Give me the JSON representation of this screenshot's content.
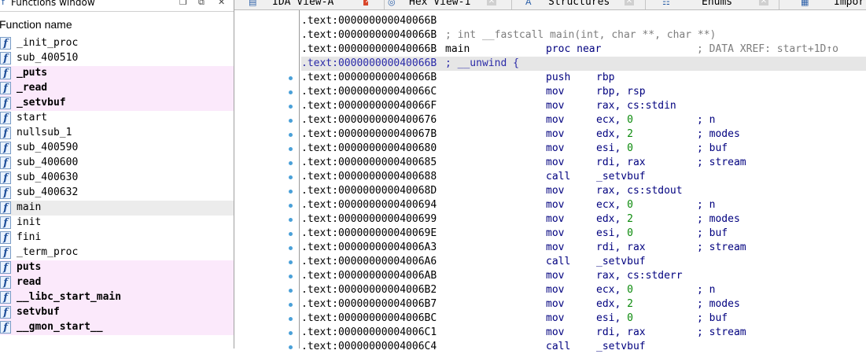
{
  "functions_window": {
    "title": "Functions window",
    "column_header": "Function name",
    "icon_glyph": "f",
    "items": [
      {
        "name": "_init_proc",
        "kind": "normal"
      },
      {
        "name": "sub_400510",
        "kind": "normal"
      },
      {
        "name": "_puts",
        "kind": "lib"
      },
      {
        "name": "_read",
        "kind": "lib"
      },
      {
        "name": "_setvbuf",
        "kind": "lib"
      },
      {
        "name": "start",
        "kind": "normal"
      },
      {
        "name": "nullsub_1",
        "kind": "normal"
      },
      {
        "name": "sub_400590",
        "kind": "normal"
      },
      {
        "name": "sub_400600",
        "kind": "normal"
      },
      {
        "name": "sub_400630",
        "kind": "normal"
      },
      {
        "name": "sub_400632",
        "kind": "normal"
      },
      {
        "name": "main",
        "kind": "selected"
      },
      {
        "name": "init",
        "kind": "normal"
      },
      {
        "name": "fini",
        "kind": "normal"
      },
      {
        "name": "_term_proc",
        "kind": "normal"
      },
      {
        "name": "puts",
        "kind": "lib"
      },
      {
        "name": "read",
        "kind": "lib"
      },
      {
        "name": "__libc_start_main",
        "kind": "lib"
      },
      {
        "name": "setvbuf",
        "kind": "lib"
      },
      {
        "name": "__gmon_start__",
        "kind": "lib"
      }
    ]
  },
  "tabs": [
    {
      "label": "IDA View-A",
      "icon": "ida-view-icon",
      "active": true
    },
    {
      "label": "Hex View-1",
      "icon": "hex-view-icon",
      "active": false
    },
    {
      "label": "Structures",
      "icon": "structures-icon",
      "active": false
    },
    {
      "label": "Enums",
      "icon": "enums-icon",
      "active": false
    },
    {
      "label": "Impor",
      "icon": "imports-icon",
      "active": false
    }
  ],
  "disassembly": {
    "lines": [
      {
        "addr": ".text:000000000040066B",
        "comment": "",
        "label": "",
        "mnem": "",
        "op": "",
        "ann": "",
        "xref": "",
        "dot": false,
        "hl": false
      },
      {
        "addr": ".text:000000000040066B",
        "comment": "; int __fastcall main(int, char **, char **)",
        "label": "",
        "mnem": "",
        "op": "",
        "ann": "",
        "xref": "",
        "dot": false,
        "hl": false
      },
      {
        "addr": ".text:000000000040066B",
        "comment": "",
        "label": "main",
        "mnem": "proc near",
        "op": "",
        "ann": "",
        "xref": "; DATA XREF: start+1D↑o",
        "dot": false,
        "hl": false
      },
      {
        "addr": ".text:000000000040066B",
        "comment": "; __unwind {",
        "label": "",
        "mnem": "",
        "op": "",
        "ann": "",
        "xref": "",
        "dot": false,
        "hl": true
      },
      {
        "addr": ".text:000000000040066B",
        "comment": "",
        "label": "",
        "mnem": "push",
        "op": "rbp",
        "ann": "",
        "xref": "",
        "dot": true,
        "hl": false
      },
      {
        "addr": ".text:000000000040066C",
        "comment": "",
        "label": "",
        "mnem": "mov",
        "op": "rbp, rsp",
        "ann": "",
        "xref": "",
        "dot": true,
        "hl": false
      },
      {
        "addr": ".text:000000000040066F",
        "comment": "",
        "label": "",
        "mnem": "mov",
        "op": "rax, cs:stdin",
        "ann": "",
        "xref": "",
        "dot": true,
        "hl": false
      },
      {
        "addr": ".text:0000000000400676",
        "comment": "",
        "label": "",
        "mnem": "mov",
        "op": "ecx, 0",
        "ann": "; n",
        "xref": "",
        "dot": true,
        "hl": false
      },
      {
        "addr": ".text:000000000040067B",
        "comment": "",
        "label": "",
        "mnem": "mov",
        "op": "edx, 2",
        "ann": "; modes",
        "xref": "",
        "dot": true,
        "hl": false
      },
      {
        "addr": ".text:0000000000400680",
        "comment": "",
        "label": "",
        "mnem": "mov",
        "op": "esi, 0",
        "ann": "; buf",
        "xref": "",
        "dot": true,
        "hl": false
      },
      {
        "addr": ".text:0000000000400685",
        "comment": "",
        "label": "",
        "mnem": "mov",
        "op": "rdi, rax",
        "ann": "; stream",
        "xref": "",
        "dot": true,
        "hl": false
      },
      {
        "addr": ".text:0000000000400688",
        "comment": "",
        "label": "",
        "mnem": "call",
        "op": "_setvbuf",
        "ann": "",
        "xref": "",
        "dot": true,
        "hl": false
      },
      {
        "addr": ".text:000000000040068D",
        "comment": "",
        "label": "",
        "mnem": "mov",
        "op": "rax, cs:stdout",
        "ann": "",
        "xref": "",
        "dot": true,
        "hl": false
      },
      {
        "addr": ".text:0000000000400694",
        "comment": "",
        "label": "",
        "mnem": "mov",
        "op": "ecx, 0",
        "ann": "; n",
        "xref": "",
        "dot": true,
        "hl": false
      },
      {
        "addr": ".text:0000000000400699",
        "comment": "",
        "label": "",
        "mnem": "mov",
        "op": "edx, 2",
        "ann": "; modes",
        "xref": "",
        "dot": true,
        "hl": false
      },
      {
        "addr": ".text:000000000040069E",
        "comment": "",
        "label": "",
        "mnem": "mov",
        "op": "esi, 0",
        "ann": "; buf",
        "xref": "",
        "dot": true,
        "hl": false
      },
      {
        "addr": ".text:00000000004006A3",
        "comment": "",
        "label": "",
        "mnem": "mov",
        "op": "rdi, rax",
        "ann": "; stream",
        "xref": "",
        "dot": true,
        "hl": false
      },
      {
        "addr": ".text:00000000004006A6",
        "comment": "",
        "label": "",
        "mnem": "call",
        "op": "_setvbuf",
        "ann": "",
        "xref": "",
        "dot": true,
        "hl": false
      },
      {
        "addr": ".text:00000000004006AB",
        "comment": "",
        "label": "",
        "mnem": "mov",
        "op": "rax, cs:stderr",
        "ann": "",
        "xref": "",
        "dot": true,
        "hl": false
      },
      {
        "addr": ".text:00000000004006B2",
        "comment": "",
        "label": "",
        "mnem": "mov",
        "op": "ecx, 0",
        "ann": "; n",
        "xref": "",
        "dot": true,
        "hl": false
      },
      {
        "addr": ".text:00000000004006B7",
        "comment": "",
        "label": "",
        "mnem": "mov",
        "op": "edx, 2",
        "ann": "; modes",
        "xref": "",
        "dot": true,
        "hl": false
      },
      {
        "addr": ".text:00000000004006BC",
        "comment": "",
        "label": "",
        "mnem": "mov",
        "op": "esi, 0",
        "ann": "; buf",
        "xref": "",
        "dot": true,
        "hl": false
      },
      {
        "addr": ".text:00000000004006C1",
        "comment": "",
        "label": "",
        "mnem": "mov",
        "op": "rdi, rax",
        "ann": "; stream",
        "xref": "",
        "dot": true,
        "hl": false
      },
      {
        "addr": ".text:00000000004006C4",
        "comment": "",
        "label": "",
        "mnem": "call",
        "op": "_setvbuf",
        "ann": "",
        "xref": "",
        "dot": true,
        "hl": false
      }
    ]
  },
  "colors": {
    "lib_row_bg": "#fbe9fb",
    "selected_row_bg": "#ececec",
    "mnemonic": "#00007f",
    "number": "#0a8a0a",
    "comment": "#7d7d7d",
    "active_tab_close": "#d9472b",
    "gutter_dot": "#4aa0d8"
  }
}
